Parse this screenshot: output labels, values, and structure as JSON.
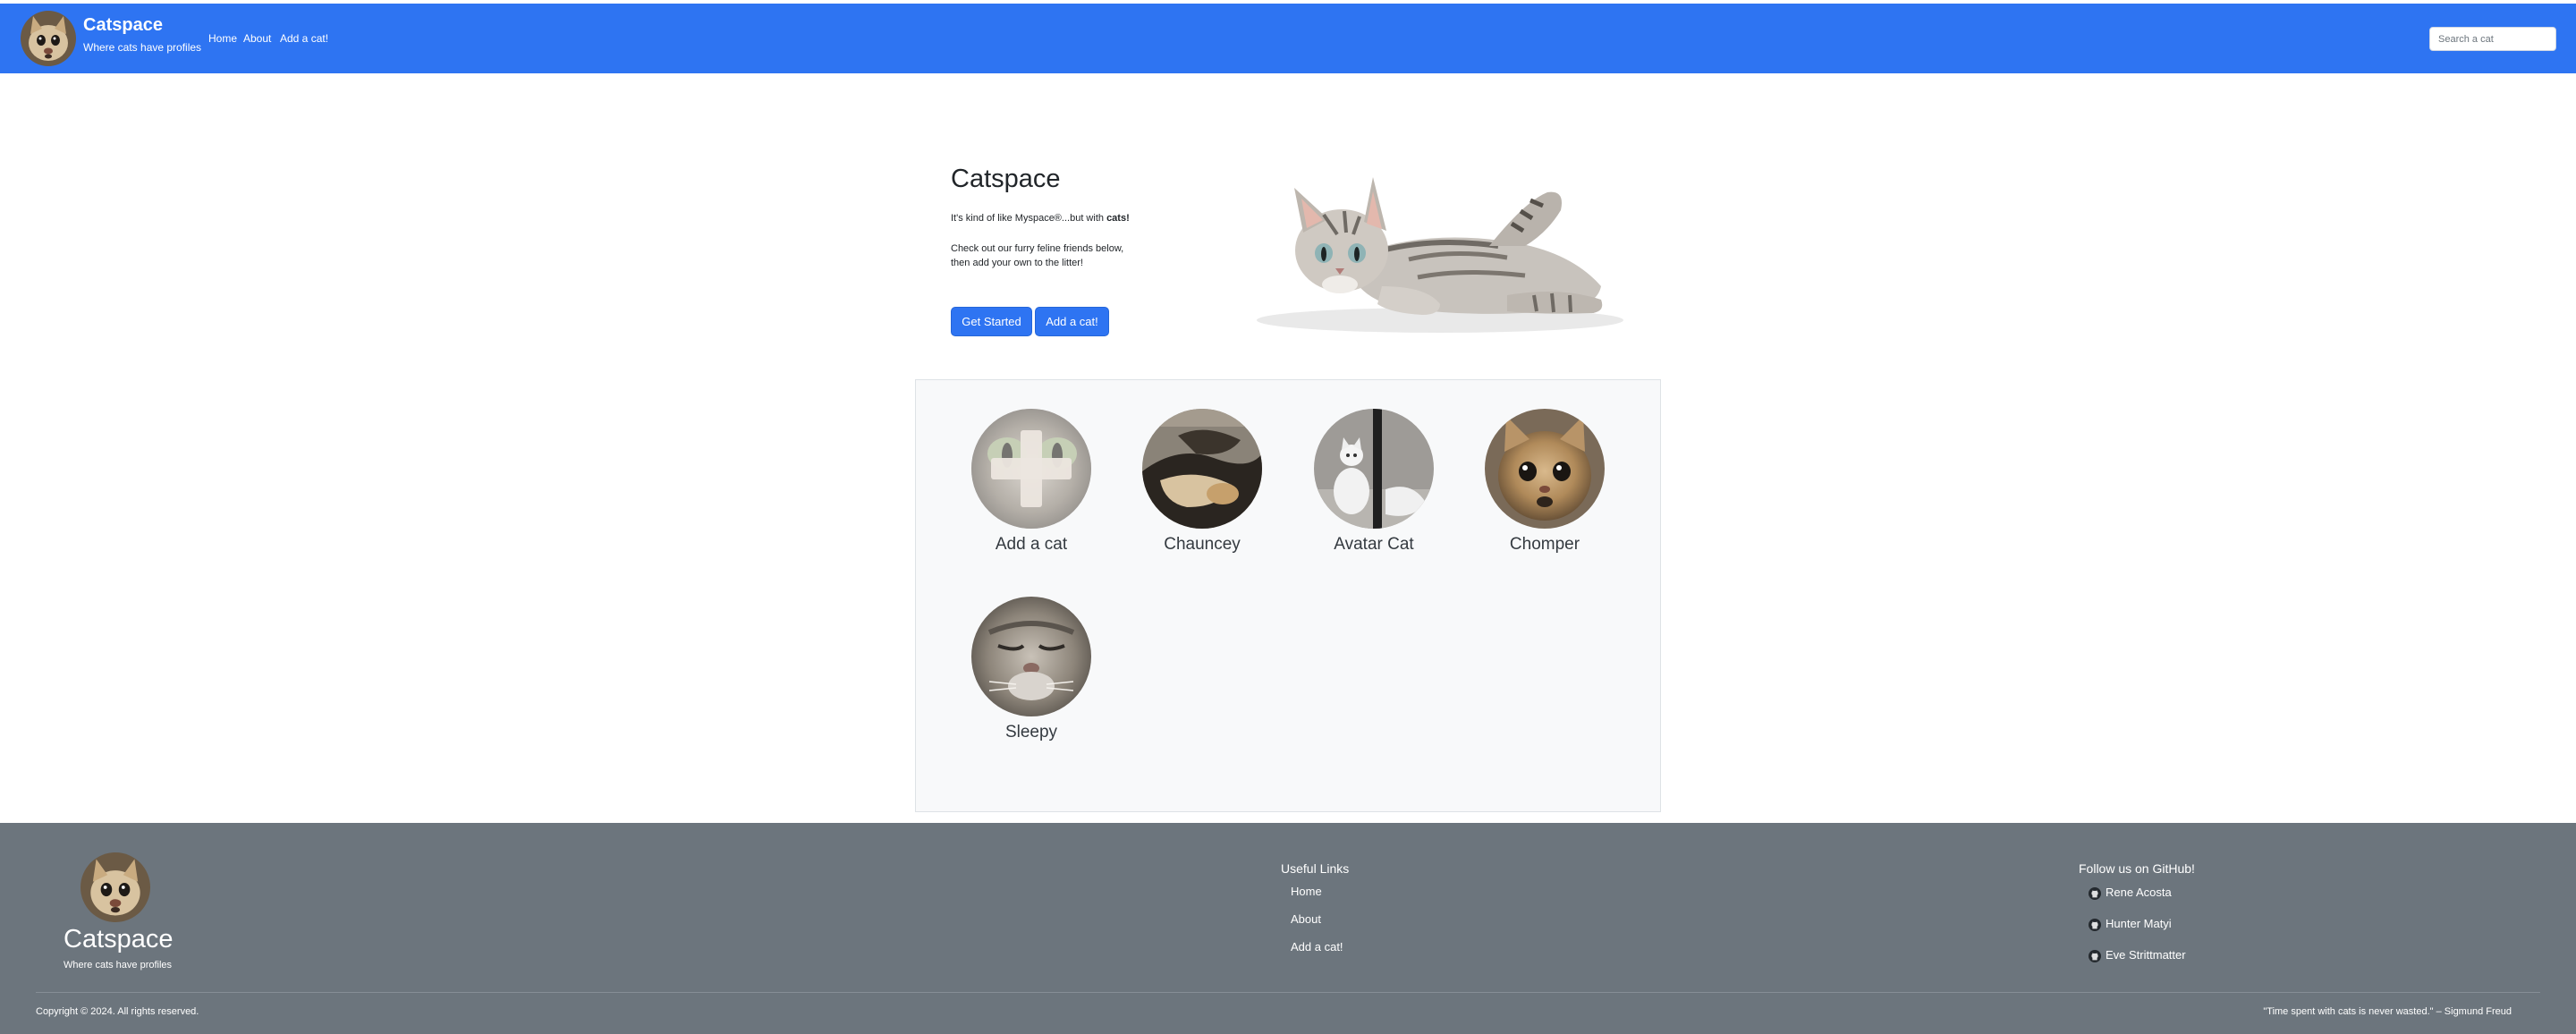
{
  "colors": {
    "primary": "#2e74f2",
    "footer": "#6c757d",
    "gallery_bg": "#f8f9fa"
  },
  "header": {
    "brand": "Catspace",
    "tagline": "Where cats have profiles",
    "nav": [
      "Home",
      "About",
      "Add a cat!"
    ],
    "search_placeholder": "Search a cat"
  },
  "hero": {
    "title": "Catspace",
    "tag_prefix": "It's kind of like Myspace®...but with ",
    "tag_bold": "cats!",
    "description": "Check out our furry feline friends below, then add your own to the litter!",
    "primary_button": "Get Started",
    "secondary_button": "Add a cat!"
  },
  "cats": [
    {
      "name": "Add a cat",
      "icon": "plus-icon"
    },
    {
      "name": "Chauncey"
    },
    {
      "name": "Avatar Cat"
    },
    {
      "name": "Chomper"
    },
    {
      "name": "Sleepy"
    }
  ],
  "footer": {
    "brand": "Catspace",
    "tagline": "Where cats have profiles",
    "links_heading": "Useful Links",
    "links": [
      "Home",
      "About",
      "Add a cat!"
    ],
    "github_heading": "Follow us on GitHub!",
    "github_icon": "github-icon",
    "github_users": [
      "Rene Acosta",
      "Hunter Matyi",
      "Eve Strittmatter"
    ],
    "copyright": "Copyright © 2024. All rights reserved.",
    "quote": "\"Time spent with cats is never wasted.\" – Sigmund Freud"
  }
}
